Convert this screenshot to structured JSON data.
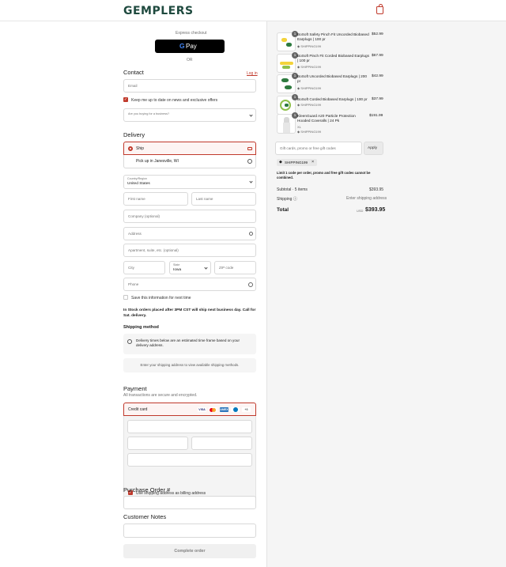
{
  "header": {
    "logo": "GEMPLERS",
    "cart_icon": "shopping-bag-icon"
  },
  "express": {
    "label": "Express checkout",
    "gpay": "Pay",
    "or": "OR"
  },
  "contact": {
    "title": "Contact",
    "login": "Log in",
    "email_placeholder": "Email",
    "news_label": "Keep me up to date on news and exclusive offers",
    "business_placeholder": "Are you buying for a business?"
  },
  "delivery": {
    "title": "Delivery",
    "ship": "Ship",
    "pickup": "Pick up in Janesville, WI",
    "country_label": "Country/Region",
    "country": "United States",
    "first_name": "First name",
    "last_name": "Last name",
    "company": "Company (optional)",
    "address": "Address",
    "apartment": "Apartment, suite, etc. (optional)",
    "city": "City",
    "state_label": "State",
    "state": "Iowa",
    "zip": "ZIP code",
    "phone": "Phone",
    "save_label": "Save this information for next time",
    "notice": "In Stock orders placed after 3PM CST will ship next business day. Call for Sat. delivery."
  },
  "shipping": {
    "title": "Shipping method",
    "info": "Delivery times below are an estimated time frame based on your delivery address.",
    "enter": "Enter your shipping address to view available shipping methods."
  },
  "payment": {
    "title": "Payment",
    "subtitle": "All transactions are secure and encrypted.",
    "credit": "Credit card",
    "billing": "Use shipping address as billing address",
    "cards": [
      "VISA",
      "MC",
      "AMEX",
      "DINERS",
      "+3"
    ]
  },
  "po": {
    "title": "Purchase Order #"
  },
  "notes": {
    "title": "Customer Notes"
  },
  "complete": "Complete order",
  "summary": {
    "items": [
      {
        "name": "BoSoft Safety Pinch Fit Uncorded Biobased Earplugs | 100 pr",
        "code": "SHIPPING199",
        "price": "$52.99",
        "qty": "1"
      },
      {
        "name": "BoSoft Pinch Fit Corded Biobased Earplugs | 100 pr",
        "code": "SHIPPING199",
        "price": "$67.99",
        "qty": "1"
      },
      {
        "name": "BoSoft Uncorded Biobased Earplugs | 200 pr",
        "code": "SHIPPING199",
        "price": "$42.99",
        "qty": "1"
      },
      {
        "name": "BoSoft Corded Biobased Earplugs | 100 pr",
        "code": "SHIPPING199",
        "price": "$37.99",
        "qty": "1"
      },
      {
        "name": "KleenGuard A20 Particle Protection Hooded Coveralls | 24 Pk",
        "variant": "XL",
        "code": "SHIPPING199",
        "price": "$191.99",
        "qty": "1"
      }
    ],
    "gift_placeholder": "Gift cards, promo or free gift codes",
    "apply": "Apply",
    "code_chip": "SHIPPING199",
    "limit": "Limit 1 code per order, promo and free gift codes cannot be combined.",
    "subtotal_label": "Subtotal · 5 items",
    "subtotal": "$393.95",
    "shipping_label": "Shipping",
    "shipping_value": "Enter shipping address",
    "total_label": "Total",
    "currency": "USD",
    "total": "$393.95"
  }
}
